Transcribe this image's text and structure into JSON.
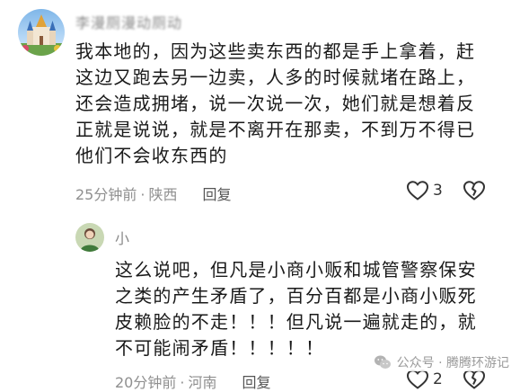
{
  "comments": [
    {
      "name": "李漫厕漫动厕动",
      "lines": [
        "我本地的，因为这些卖东西的都是手上拿着，赶",
        "这边又跑去另一边卖，人多的时候就堵在路上，",
        "还会造成拥堵，说一次说一次，她们就是想着反",
        "正就是说说，就是不离开在那卖，不到万不得已",
        "他们不会收东西的"
      ],
      "time": "25分钟前",
      "dot": "·",
      "location": "陕西",
      "reply": "回复",
      "likes": "3"
    },
    {
      "name": "小",
      "lines": [
        "这么说吧，但凡是小商小贩和城管警察保安",
        "之类的产生矛盾了，百分百都是小商小贩死",
        "皮赖脸的不走！！！但凡说一遍就走的，就",
        "不可能闹矛盾！！！！！"
      ],
      "time": "20分钟前",
      "dot": "·",
      "location": "河南",
      "reply": "回复",
      "likes": "2"
    }
  ],
  "watermark": {
    "text": "公众号 · 腾腾环游记",
    "icon": "wechat-icon"
  },
  "colors": {
    "meta": "#8f8f8f",
    "text": "#1a1a1a"
  }
}
